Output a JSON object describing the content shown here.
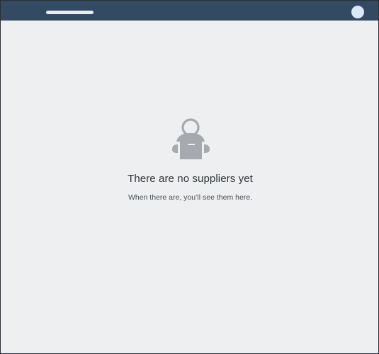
{
  "header": {
    "avatar_icon": "user-avatar-icon",
    "bar_color": "#344a63"
  },
  "empty_state": {
    "icon": "supplier-person-icon",
    "title": "There are no suppliers yet",
    "subtitle": "When there are, you’ll see them here."
  }
}
